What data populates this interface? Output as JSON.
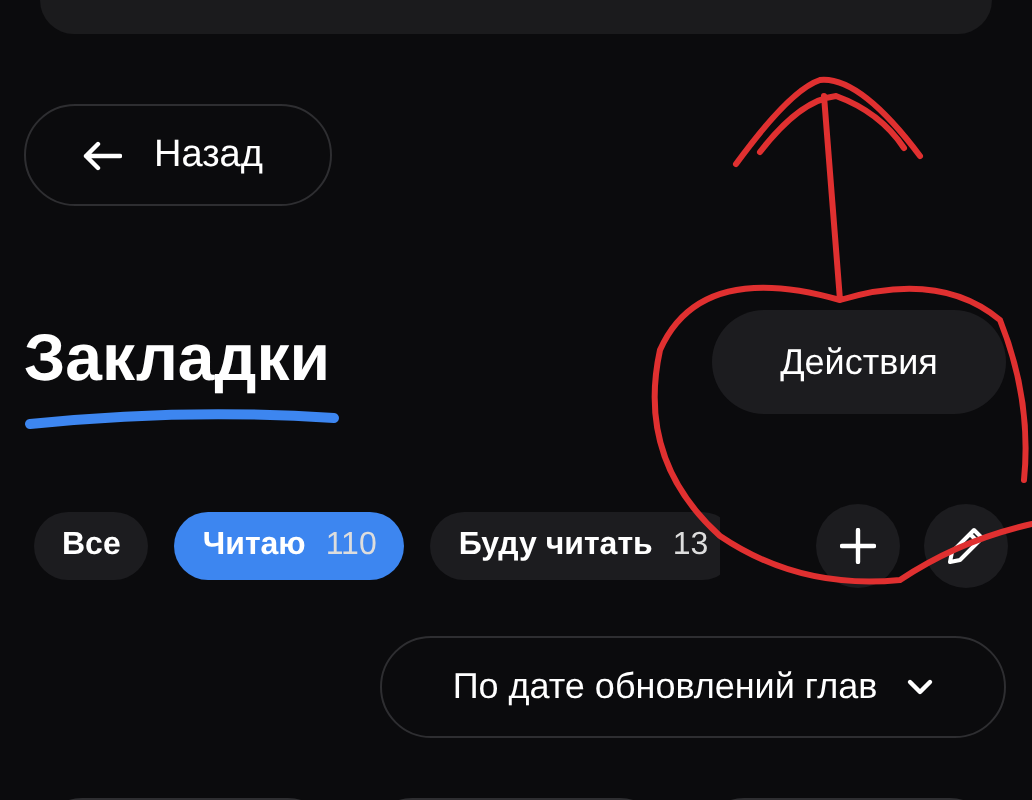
{
  "back_button": {
    "label": "Назад"
  },
  "title": "Закладки",
  "actions_button": {
    "label": "Действия"
  },
  "filters": [
    {
      "label": "Все",
      "selected": false
    },
    {
      "label": "Читаю",
      "count": "110",
      "selected": true
    },
    {
      "label": "Буду читать",
      "count": "13",
      "selected": false
    }
  ],
  "sort_dropdown": {
    "label": "По дате обновлений глав"
  }
}
